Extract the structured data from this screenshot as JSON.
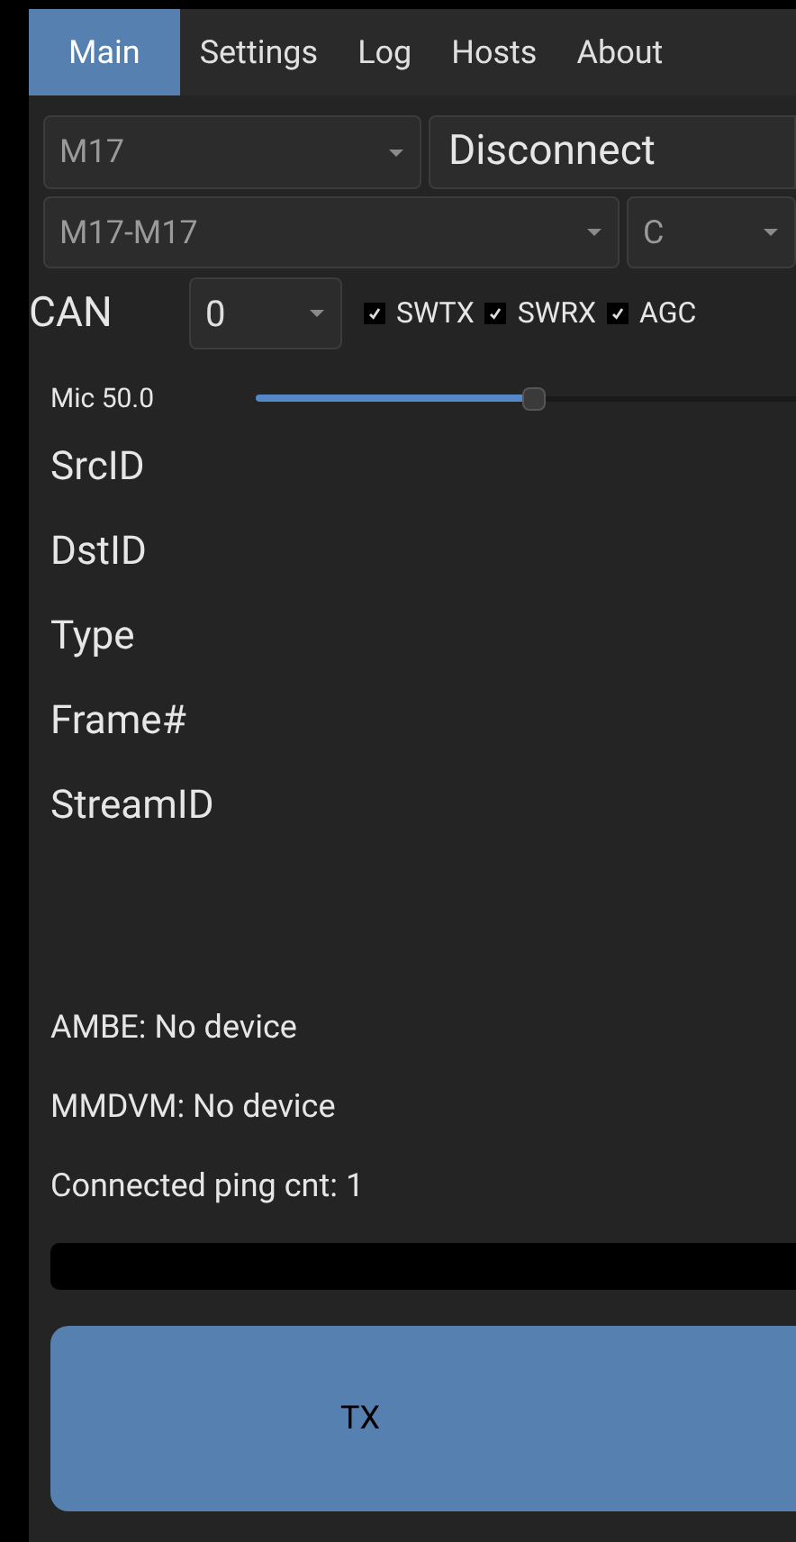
{
  "tabs": [
    {
      "label": "Main",
      "selected": true
    },
    {
      "label": "Settings",
      "selected": false
    },
    {
      "label": "Log",
      "selected": false
    },
    {
      "label": "Hosts",
      "selected": false
    },
    {
      "label": "About",
      "selected": false
    }
  ],
  "mode_select": {
    "value": "M17"
  },
  "connect_button": {
    "label": "Disconnect"
  },
  "host_select": {
    "value": "M17-M17"
  },
  "module_select": {
    "value": "C"
  },
  "can": {
    "label": "CAN",
    "value": "0"
  },
  "checkboxes": [
    {
      "label": "SWTX",
      "checked": true
    },
    {
      "label": "SWRX",
      "checked": true
    },
    {
      "label": "AGC",
      "checked": true
    }
  ],
  "mic": {
    "label": "Mic 50.0",
    "level": 0.5
  },
  "fields": [
    "SrcID",
    "DstID",
    "Type",
    "Frame#",
    "StreamID"
  ],
  "status": [
    "AMBE: No device",
    "MMDVM: No device",
    "Connected ping cnt: 1"
  ],
  "tx_button": {
    "label": "TX"
  }
}
